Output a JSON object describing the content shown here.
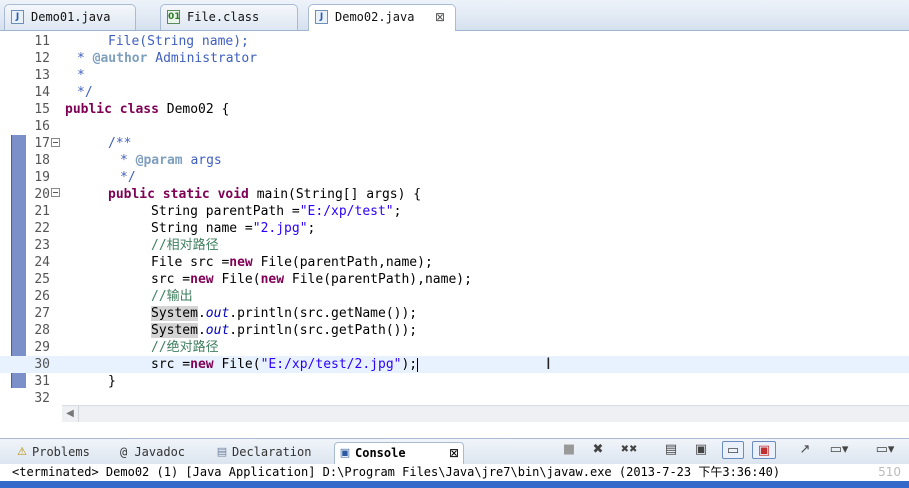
{
  "editor_tabs": [
    {
      "label": "Demo01.java",
      "icon": "java-file-icon",
      "active": false
    },
    {
      "label": "File.class",
      "icon": "class-file-icon",
      "active": false
    },
    {
      "label": "Demo02.java",
      "icon": "java-file-icon",
      "active": true,
      "close": "⊠"
    }
  ],
  "code_lines": [
    {
      "num": "11"
    },
    {
      "num": "12"
    },
    {
      "num": "13"
    },
    {
      "num": "14"
    },
    {
      "num": "15"
    },
    {
      "num": "16"
    },
    {
      "num": "17"
    },
    {
      "num": "18"
    },
    {
      "num": "19"
    },
    {
      "num": "20"
    },
    {
      "num": "21"
    },
    {
      "num": "22"
    },
    {
      "num": "23"
    },
    {
      "num": "24"
    },
    {
      "num": "25"
    },
    {
      "num": "26"
    },
    {
      "num": "27"
    },
    {
      "num": "28"
    },
    {
      "num": "29"
    },
    {
      "num": "30"
    },
    {
      "num": "31"
    },
    {
      "num": "32"
    }
  ],
  "code": {
    "l11": "File(String name);",
    "l12_star": "*",
    "l12_tag": "@author",
    "l12_text": "Administrator",
    "l13": "*",
    "l14": "*/",
    "l15_kw": "public class",
    "l15_name": "Demo02 {",
    "l17": "/**",
    "l18_star": "*",
    "l18_tag": "@param",
    "l18_text": "args",
    "l19": "*/",
    "l20_kw": "public static void",
    "l20_rest": "main(String[] args) {",
    "l21_a": "String parentPath =",
    "l21_s": "\"E:/xp/test\"",
    "l21_b": ";",
    "l22_a": "String name =",
    "l22_s": "\"2.jpg\"",
    "l22_b": ";",
    "l23": "//相对路径",
    "l24_a": "File src =",
    "l24_kw": "new",
    "l24_b": "File(parentPath,name);",
    "l25_a": "src =",
    "l25_kw": "new",
    "l25_b": "File(",
    "l25_kw2": "new",
    "l25_c": "File(parentPath),name);",
    "l26": "//输出",
    "l27_sys": "System",
    "l27_dot": ".",
    "l27_out": "out",
    "l27_rest": ".println(src.getName());",
    "l28_sys": "System",
    "l28_dot": ".",
    "l28_out": "out",
    "l28_rest": ".println(src.getPath());",
    "l29": "//绝对路径",
    "l30_a": "src =",
    "l30_kw": "new",
    "l30_b": "File(",
    "l30_s": "\"E:/xp/test/2.jpg\"",
    "l30_c": ");",
    "l31": "}",
    "ibeam": "I"
  },
  "views_tabs": [
    {
      "label": "Problems",
      "icon": "problems-icon",
      "glyph": "⚠"
    },
    {
      "label": "@ Javadoc",
      "icon": "javadoc-icon",
      "glyph": ""
    },
    {
      "label": "Declaration",
      "icon": "declaration-icon",
      "glyph": "▤"
    },
    {
      "label": "Console",
      "icon": "console-icon",
      "glyph": "▣",
      "active": true,
      "close": "⊠"
    }
  ],
  "console_toolbar": [
    "■",
    "✖",
    "✖✖",
    "▤",
    "▣",
    "▭",
    "▣",
    "↗",
    "▭▾",
    "▭▾"
  ],
  "console_status": "<terminated> Demo02 (1) [Java Application] D:\\Program Files\\Java\\jre7\\bin\\javaw.exe (2013-7-23 下午3:36:40)",
  "watermark": "510",
  "colors": {
    "keyword": "#7f0055",
    "string": "#2a00ff",
    "javadoc": "#3f5fbf",
    "comment": "#3f7f5f",
    "static_field": "#0000c0",
    "current_line": "#e8f2fe",
    "gutter_marker": "#7b8fc9"
  }
}
